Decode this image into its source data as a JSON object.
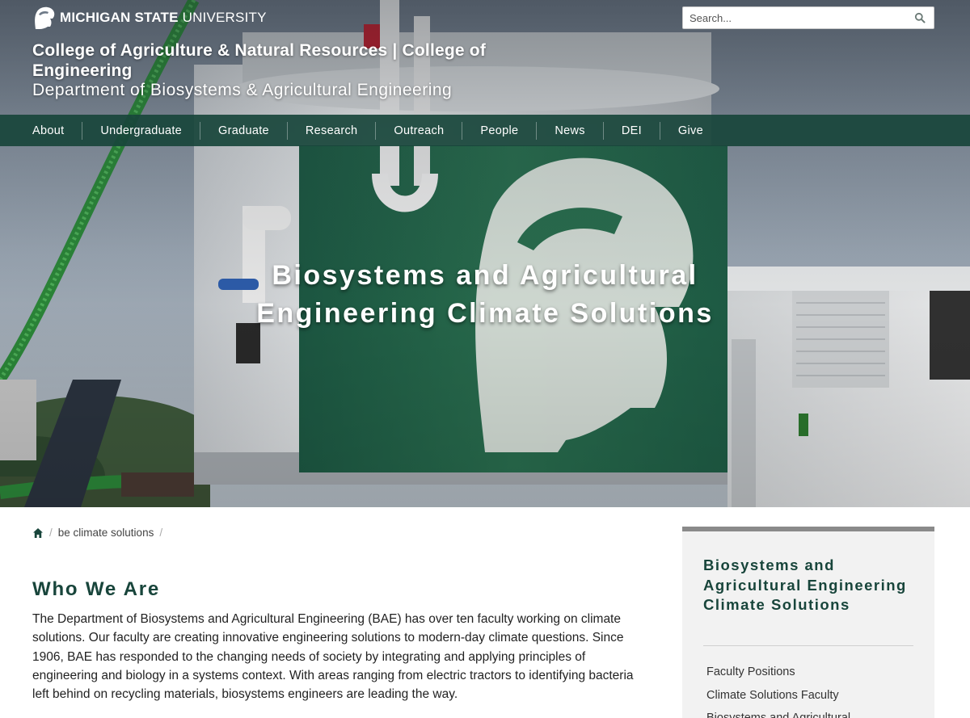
{
  "header": {
    "wordmark_bold": "MICHIGAN STATE",
    "wordmark_light": " UNIVERSITY",
    "college_line": "College of Agriculture & Natural Resources | College of Engineering",
    "department_line": "Department of Biosystems & Agricultural Engineering",
    "search": {
      "placeholder": "Search..."
    }
  },
  "nav": {
    "items": [
      {
        "label": "About"
      },
      {
        "label": "Undergraduate"
      },
      {
        "label": "Graduate"
      },
      {
        "label": "Research"
      },
      {
        "label": "Outreach"
      },
      {
        "label": "People"
      },
      {
        "label": "News"
      },
      {
        "label": "DEI"
      },
      {
        "label": "Give"
      }
    ]
  },
  "hero": {
    "title": "Biosystems and Agricultural Engineering Climate Solutions"
  },
  "breadcrumb": {
    "current": "be climate solutions",
    "separator": "/"
  },
  "main": {
    "title": "Who We Are",
    "body": "The Department of Biosystems and Agricultural Engineering (BAE) has over ten faculty working on climate solutions. Our faculty are creating innovative engineering solutions to modern-day climate questions. Since 1906, BAE has responded to the changing needs of society by integrating and applying principles of engineering and biology in a systems context. With areas ranging from electric tractors to identifying bacteria left behind on recycling materials, biosystems engineers are leading the way."
  },
  "sidebar": {
    "title": "Biosystems and Agricultural Engineering Climate Solutions",
    "links": [
      {
        "label": "Faculty Positions"
      },
      {
        "label": "Climate Solutions Faculty"
      },
      {
        "label": "Biosystems and Agricultural"
      }
    ]
  },
  "colors": {
    "msu_green": "#18453b",
    "nav_bg": "#18453b",
    "text": "#222222",
    "sidebar_bg": "#f2f2f2"
  }
}
